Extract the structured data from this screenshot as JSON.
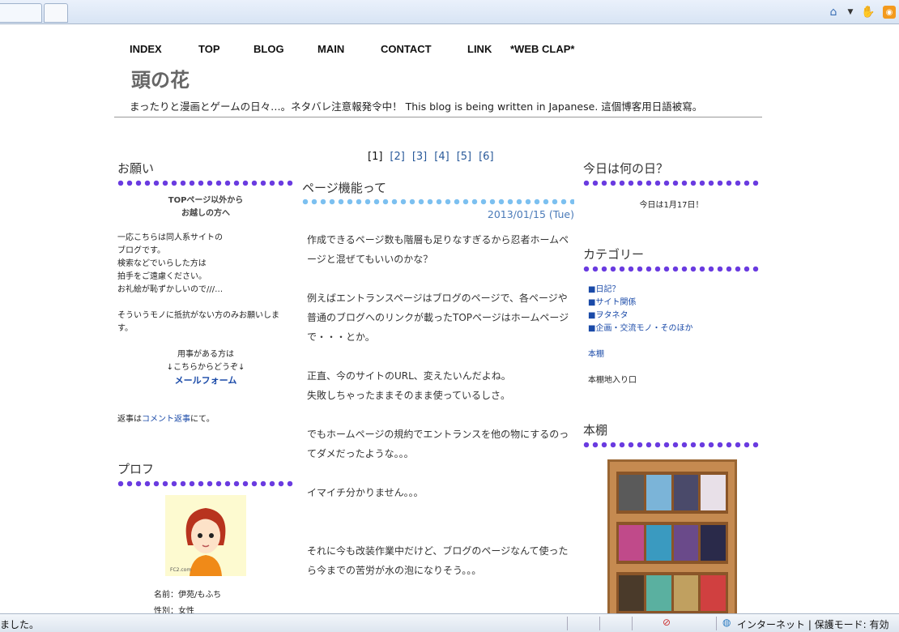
{
  "browser": {
    "status_text": "ました。",
    "zone_text": "インターネット | 保護モード: 有効"
  },
  "nav": [
    "INDEX",
    "TOP",
    "BLOG",
    "MAIN",
    "CONTACT",
    "LINK",
    "*WEB CLAP*"
  ],
  "site": {
    "title": "頭の花",
    "description": "まったりと漫画とゲームの日々…。ネタバレ注意報発令中！ This blog is being written in Japanese. 這個博客用日語被寫。"
  },
  "pager": [
    "[1]",
    "[2]",
    "[3]",
    "[4]",
    "[5]",
    "[6]"
  ],
  "left": {
    "onegai_heading": "お願い",
    "notice_title_1": "TOPページ以外から",
    "notice_title_2": "お越しの方へ",
    "notice_lines": [
      "一応こちらは同人系サイトの",
      "ブログです。",
      "検索などでいらした方は",
      "拍手をご遠慮ください。",
      "お礼絵が恥ずかしいので///…"
    ],
    "notice_extra": "そういうモノに抵抗がない方のみお願いします。",
    "contact_1": "用事がある方は",
    "contact_2": "↓こちらからどうぞ↓",
    "mail_link": "メールフォーム",
    "reply_prefix": "返事は",
    "reply_link": "コメント返事",
    "reply_suffix": "にて。",
    "profile_heading": "プロフ",
    "profile_name": "名前：伊苑/もふち",
    "profile_gender": "性別：女性"
  },
  "article": {
    "title": "ページ機能って",
    "date": "2013/01/15 (Tue)",
    "paragraphs": [
      "作成できるページ数も階層も足りなすぎるから忍者ホームページと混ぜてもいいのかな？",
      "例えばエントランスページはブログのページで、各ページや普通のブログへのリンクが載ったTOPページはホームページで・・・とか。",
      "正直、今のサイトのURL、変えたいんだよね。\n失敗しちゃったままそのまま使っているしさ。",
      "でもホームページの規約でエントランスを他の物にするのってダメだったような。。。",
      "イマイチ分かりません。。。",
      "それに今も改装作業中だけど、ブログのページなんて使ったら今までの苦労が水の泡になりそう。。。"
    ]
  },
  "right": {
    "today_heading": "今日は何の日？",
    "today_text": "今日は1月17日！",
    "category_heading": "カテゴリー",
    "categories": [
      "■日記？",
      "■サイト関係",
      "■ヲタネタ",
      "■企画・交流モノ・そのほか"
    ],
    "bookshelf_link": "本棚",
    "bookshelf_entry": "本棚地入り口",
    "shelf_heading": "本棚"
  },
  "colors": {
    "dot_purple": "#6a3be0",
    "dot_blue": "#7cc0f0",
    "link": "#1a4aa8",
    "date": "#4a7ab8"
  }
}
